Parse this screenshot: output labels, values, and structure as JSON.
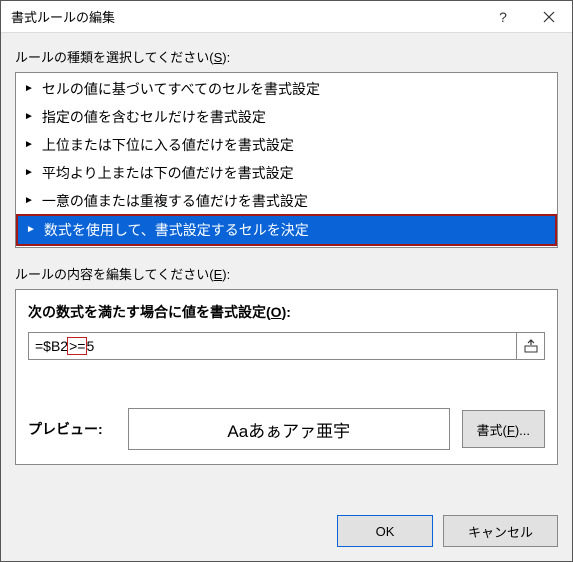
{
  "titlebar": {
    "title": "書式ルールの編集"
  },
  "sections": {
    "rule_type_label": "ルールの種類を選択してください(",
    "rule_type_key": "S",
    "rule_type_label_end": "):",
    "edit_label": "ルールの内容を編集してください(",
    "edit_key": "E",
    "edit_label_end": "):"
  },
  "rule_types": {
    "items": [
      "セルの値に基づいてすべてのセルを書式設定",
      "指定の値を含むセルだけを書式設定",
      "上位または下位に入る値だけを書式設定",
      "平均より上または下の値だけを書式設定",
      "一意の値または重複する値だけを書式設定",
      "数式を使用して、書式設定するセルを決定"
    ],
    "selected_index": 5
  },
  "formula": {
    "label": "次の数式を満たす場合に値を書式設定(",
    "key": "O",
    "label_end": "):",
    "pre": "=$B2",
    "highlight": ">=",
    "post": "5"
  },
  "preview": {
    "label": "プレビュー:",
    "sample": "Aaあぁアァ亜宇",
    "format_btn": "書式(",
    "format_key": "F",
    "format_btn_end": ")..."
  },
  "footer": {
    "ok": "OK",
    "cancel": "キャンセル"
  }
}
